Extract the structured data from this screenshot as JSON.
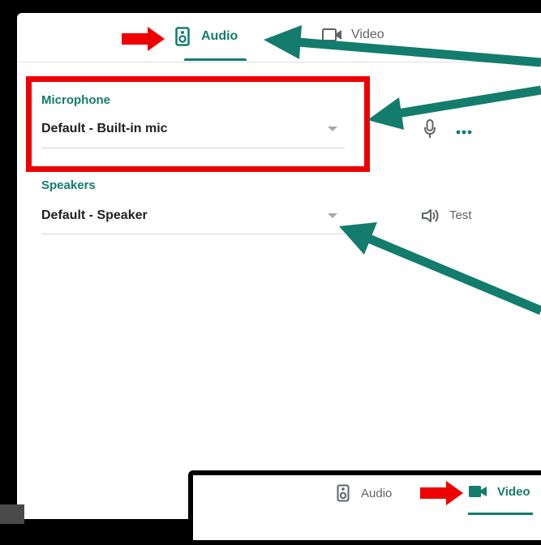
{
  "tabs": {
    "audio_label": "Audio",
    "video_label": "Video",
    "audio_icon": "speaker-icon",
    "video_icon": "video-camera-icon"
  },
  "microphone": {
    "label": "Microphone",
    "selected": "Default - Built-in mic",
    "icon": "microphone-icon",
    "more_icon": "more-horizontal-icon"
  },
  "speakers": {
    "label": "Speakers",
    "selected": "Default - Speaker",
    "test_label": "Test",
    "test_icon": "volume-icon"
  },
  "colors": {
    "accent": "#137c6d",
    "annotation_arrow": "#137c6d",
    "highlight_red": "#ee0000"
  }
}
